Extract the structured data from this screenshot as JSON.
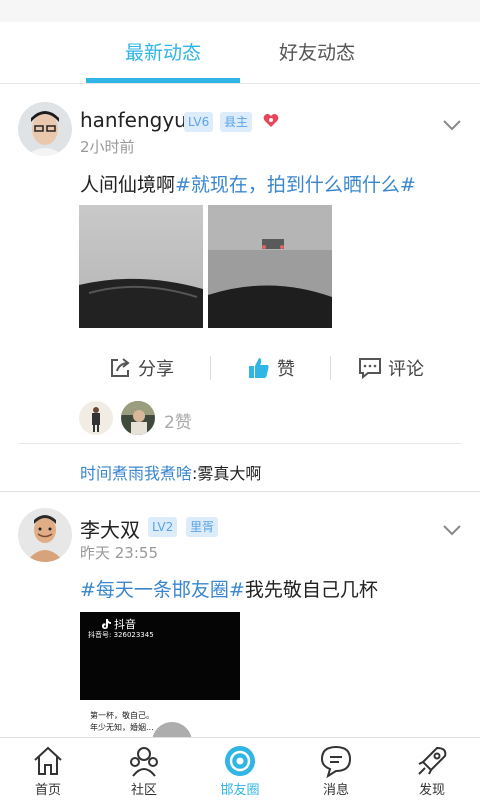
{
  "tabs": [
    {
      "label": "最新动态",
      "active": true
    },
    {
      "label": "好友动态",
      "active": false
    }
  ],
  "colors": {
    "accent": "#2fb5e6",
    "tag": "#3a87cf",
    "badge_bg": "#dcecfb",
    "badge_text": "#5aa3e8",
    "heart": "#e8445a"
  },
  "posts": [
    {
      "username": "hanfengyu",
      "level": "LV6",
      "role": "县主",
      "time": "2小时前",
      "content_text": "人间仙境啊",
      "content_tag": "#就现在，拍到什么晒什么#",
      "actions": {
        "share": "分享",
        "like": "赞",
        "comment": "评论"
      },
      "likes": "2赞",
      "comment_user": "时间煮雨我煮啥",
      "comment_text": ":雾真大啊"
    },
    {
      "username": "李大双",
      "level": "LV2",
      "role": "里胥",
      "time": "昨天 23:55",
      "content_tag": "#每天一条邯友圈#",
      "content_text": "我先敬自己几杯",
      "video_app": "抖音",
      "video_id": "抖音号: 326023345",
      "caption_line1": "第一杯，敬自己。",
      "caption_line2": "年少无知，婚姻..."
    }
  ],
  "nav": [
    {
      "label": "首页",
      "icon": "home-icon"
    },
    {
      "label": "社区",
      "icon": "community-icon"
    },
    {
      "label": "邯友圈",
      "icon": "circle-icon",
      "active": true
    },
    {
      "label": "消息",
      "icon": "message-icon"
    },
    {
      "label": "发现",
      "icon": "discover-icon"
    }
  ]
}
